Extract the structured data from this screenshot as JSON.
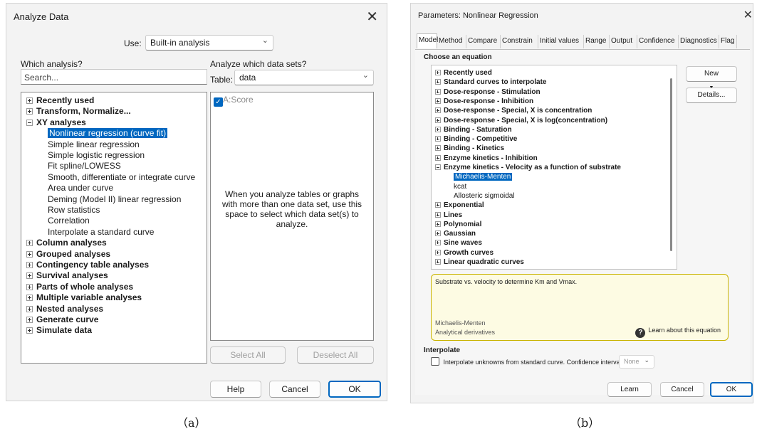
{
  "left": {
    "title": "Analyze Data",
    "use_label": "Use:",
    "use_value": "Built-in analysis",
    "which_label": "Which analysis?",
    "search_placeholder": "Search...",
    "analyze_label": "Analyze which data sets?",
    "table_label": "Table:",
    "table_value": "data",
    "dataset": "A:Score",
    "hint": "When you analyze tables or graphs with more than one data set, use this space to select which data set(s) to analyze.",
    "select_all": "Select All",
    "deselect_all": "Deselect All",
    "help": "Help",
    "cancel": "Cancel",
    "ok": "OK",
    "tree": [
      {
        "label": "Recently used",
        "type": "group",
        "open": false
      },
      {
        "label": "Transform, Normalize...",
        "type": "group",
        "open": false
      },
      {
        "label": "XY analyses",
        "type": "group",
        "open": true
      },
      {
        "label": "Nonlinear regression (curve fit)",
        "type": "child",
        "selected": true
      },
      {
        "label": "Simple linear regression",
        "type": "child"
      },
      {
        "label": "Simple logistic regression",
        "type": "child"
      },
      {
        "label": "Fit spline/LOWESS",
        "type": "child"
      },
      {
        "label": "Smooth, differentiate or integrate curve",
        "type": "child"
      },
      {
        "label": "Area under curve",
        "type": "child"
      },
      {
        "label": "Deming (Model II) linear regression",
        "type": "child"
      },
      {
        "label": "Row statistics",
        "type": "child"
      },
      {
        "label": "Correlation",
        "type": "child"
      },
      {
        "label": "Interpolate a standard curve",
        "type": "child"
      },
      {
        "label": "Column analyses",
        "type": "group",
        "open": false
      },
      {
        "label": "Grouped analyses",
        "type": "group",
        "open": false
      },
      {
        "label": "Contingency table analyses",
        "type": "group",
        "open": false
      },
      {
        "label": "Survival analyses",
        "type": "group",
        "open": false
      },
      {
        "label": "Parts of whole analyses",
        "type": "group",
        "open": false
      },
      {
        "label": "Multiple variable analyses",
        "type": "group",
        "open": false
      },
      {
        "label": "Nested analyses",
        "type": "group",
        "open": false
      },
      {
        "label": "Generate curve",
        "type": "group",
        "open": false
      },
      {
        "label": "Simulate data",
        "type": "group",
        "open": false
      }
    ]
  },
  "right": {
    "title": "Parameters: Nonlinear Regression",
    "tabs": [
      "Model",
      "Method",
      "Compare",
      "Constrain",
      "Initial values",
      "Range",
      "Output",
      "Confidence",
      "Diagnostics",
      "Flag"
    ],
    "choose_label": "Choose an equation",
    "new_button": "New",
    "details_button": "Details...",
    "tree": [
      {
        "label": "Recently used",
        "type": "group",
        "open": false
      },
      {
        "label": "Standard curves to interpolate",
        "type": "group",
        "open": false
      },
      {
        "label": "Dose-response - Stimulation",
        "type": "group",
        "open": false
      },
      {
        "label": "Dose-response - Inhibition",
        "type": "group",
        "open": false
      },
      {
        "label": "Dose-response - Special, X is concentration",
        "type": "group",
        "open": false
      },
      {
        "label": "Dose-response - Special, X is log(concentration)",
        "type": "group",
        "open": false
      },
      {
        "label": "Binding - Saturation",
        "type": "group",
        "open": false
      },
      {
        "label": "Binding - Competitive",
        "type": "group",
        "open": false
      },
      {
        "label": "Binding - Kinetics",
        "type": "group",
        "open": false
      },
      {
        "label": "Enzyme kinetics - Inhibition",
        "type": "group",
        "open": false
      },
      {
        "label": "Enzyme kinetics - Velocity as a function of substrate",
        "type": "group",
        "open": true
      },
      {
        "label": "Michaelis-Menten",
        "type": "child",
        "selected": true
      },
      {
        "label": "kcat",
        "type": "child"
      },
      {
        "label": "Allosteric sigmoidal",
        "type": "child"
      },
      {
        "label": "Exponential",
        "type": "group",
        "open": false
      },
      {
        "label": "Lines",
        "type": "group",
        "open": false
      },
      {
        "label": "Polynomial",
        "type": "group",
        "open": false
      },
      {
        "label": "Gaussian",
        "type": "group",
        "open": false
      },
      {
        "label": "Sine waves",
        "type": "group",
        "open": false
      },
      {
        "label": "Growth curves",
        "type": "group",
        "open": false
      },
      {
        "label": "Linear quadratic curves",
        "type": "group",
        "open": false
      }
    ],
    "description": "Substrate vs. velocity to determine Km and Vmax.",
    "desc_name": "Michaelis-Menten",
    "desc_sub": "Analytical derivatives",
    "learn_equation": "Learn about this equation",
    "interpolate_heading": "Interpolate",
    "interpolate_text": "Interpolate unknowns from standard curve. Confidence interval:",
    "ci_value": "None",
    "learn": "Learn",
    "cancel": "Cancel",
    "ok": "OK"
  },
  "captions": {
    "a": "（a）",
    "b": "（b）"
  }
}
